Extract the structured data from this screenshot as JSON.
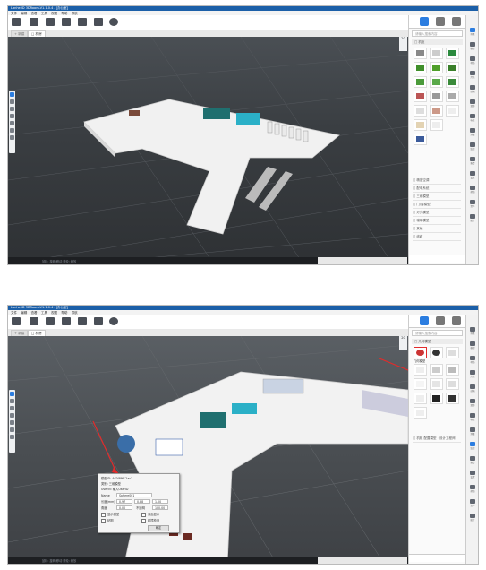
{
  "window": {
    "title": "Lanhe3D 3DRoom-V1.1.0.4 - [办公室]",
    "menu": [
      "文件",
      "编辑",
      "查看",
      "工具",
      "视图",
      "帮助",
      "导航"
    ]
  },
  "tabs": {
    "tab1": "+ 新建",
    "tab2": "□ 机房"
  },
  "panel": {
    "search_placeholder": "请输入搜索内容",
    "sub_shot1": "□ 机柜",
    "sub_shot2": "□ 几何模型",
    "categories_shot1": [
      "□ 精密空调",
      "□ 配电系统",
      "□ 三维模型",
      "□ 门/窗模型",
      "□ 灯光模型",
      "□ 辅助模型",
      "□ 其他",
      "□ 线缆"
    ],
    "categories_shot2": [
      "□ 机柜 配置模型（设计工程师）"
    ],
    "thumb_label_shot2": "几何模型"
  },
  "viewport": {
    "zoom": "20",
    "status": "鼠标: 旋转/移动  滚轮: 缩放"
  },
  "right_icons": [
    "场景",
    "模型",
    "材质",
    "灯光",
    "动画",
    "漫游",
    "标注",
    "测量",
    "监控",
    "报警",
    "设置",
    "帮助",
    "资产",
    "统计",
    "配置",
    "退出"
  ],
  "properties": {
    "name_label": "Name",
    "name_value": "Sphere001",
    "fields": {
      "len_label": "长度(mm)",
      "len_x": "0.97",
      "len_y": "0.88",
      "len_z": "1.00",
      "rot_label": "角度",
      "rot_x": "0.00",
      "rot_right": "100.00",
      "opacity_label": "不透明"
    },
    "header_lines": [
      "模型ID: 4d2f8f6f-2ac3-...",
      "类别: 三维模型",
      "UserId: 输入UserID"
    ],
    "check_labels": [
      "显示模型",
      "双面显示",
      "贴图",
      "碰撞检测"
    ],
    "button": "确定"
  },
  "colors": {
    "title_bar": "#1b5fa8",
    "viewport_bg": "#3a3e42",
    "accent": "#2b7de0",
    "red_arrow": "#e22b2b"
  }
}
